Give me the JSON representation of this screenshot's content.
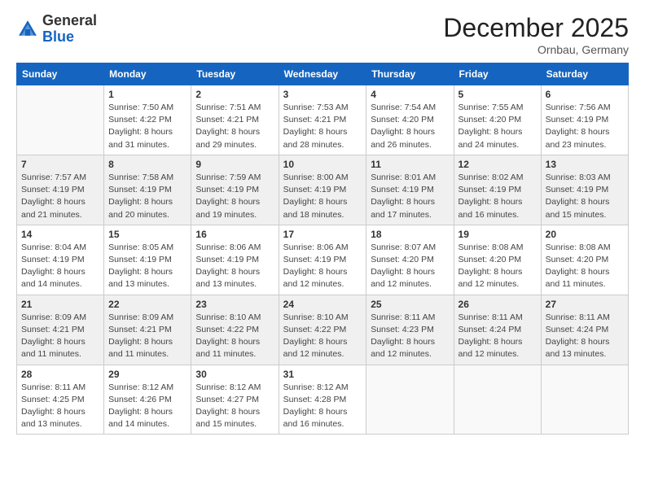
{
  "logo": {
    "general": "General",
    "blue": "Blue"
  },
  "title": "December 2025",
  "subtitle": "Ornbau, Germany",
  "headers": [
    "Sunday",
    "Monday",
    "Tuesday",
    "Wednesday",
    "Thursday",
    "Friday",
    "Saturday"
  ],
  "weeks": [
    [
      {
        "day": "",
        "info": ""
      },
      {
        "day": "1",
        "info": "Sunrise: 7:50 AM\nSunset: 4:22 PM\nDaylight: 8 hours\nand 31 minutes."
      },
      {
        "day": "2",
        "info": "Sunrise: 7:51 AM\nSunset: 4:21 PM\nDaylight: 8 hours\nand 29 minutes."
      },
      {
        "day": "3",
        "info": "Sunrise: 7:53 AM\nSunset: 4:21 PM\nDaylight: 8 hours\nand 28 minutes."
      },
      {
        "day": "4",
        "info": "Sunrise: 7:54 AM\nSunset: 4:20 PM\nDaylight: 8 hours\nand 26 minutes."
      },
      {
        "day": "5",
        "info": "Sunrise: 7:55 AM\nSunset: 4:20 PM\nDaylight: 8 hours\nand 24 minutes."
      },
      {
        "day": "6",
        "info": "Sunrise: 7:56 AM\nSunset: 4:19 PM\nDaylight: 8 hours\nand 23 minutes."
      }
    ],
    [
      {
        "day": "7",
        "info": "Sunrise: 7:57 AM\nSunset: 4:19 PM\nDaylight: 8 hours\nand 21 minutes."
      },
      {
        "day": "8",
        "info": "Sunrise: 7:58 AM\nSunset: 4:19 PM\nDaylight: 8 hours\nand 20 minutes."
      },
      {
        "day": "9",
        "info": "Sunrise: 7:59 AM\nSunset: 4:19 PM\nDaylight: 8 hours\nand 19 minutes."
      },
      {
        "day": "10",
        "info": "Sunrise: 8:00 AM\nSunset: 4:19 PM\nDaylight: 8 hours\nand 18 minutes."
      },
      {
        "day": "11",
        "info": "Sunrise: 8:01 AM\nSunset: 4:19 PM\nDaylight: 8 hours\nand 17 minutes."
      },
      {
        "day": "12",
        "info": "Sunrise: 8:02 AM\nSunset: 4:19 PM\nDaylight: 8 hours\nand 16 minutes."
      },
      {
        "day": "13",
        "info": "Sunrise: 8:03 AM\nSunset: 4:19 PM\nDaylight: 8 hours\nand 15 minutes."
      }
    ],
    [
      {
        "day": "14",
        "info": "Sunrise: 8:04 AM\nSunset: 4:19 PM\nDaylight: 8 hours\nand 14 minutes."
      },
      {
        "day": "15",
        "info": "Sunrise: 8:05 AM\nSunset: 4:19 PM\nDaylight: 8 hours\nand 13 minutes."
      },
      {
        "day": "16",
        "info": "Sunrise: 8:06 AM\nSunset: 4:19 PM\nDaylight: 8 hours\nand 13 minutes."
      },
      {
        "day": "17",
        "info": "Sunrise: 8:06 AM\nSunset: 4:19 PM\nDaylight: 8 hours\nand 12 minutes."
      },
      {
        "day": "18",
        "info": "Sunrise: 8:07 AM\nSunset: 4:20 PM\nDaylight: 8 hours\nand 12 minutes."
      },
      {
        "day": "19",
        "info": "Sunrise: 8:08 AM\nSunset: 4:20 PM\nDaylight: 8 hours\nand 12 minutes."
      },
      {
        "day": "20",
        "info": "Sunrise: 8:08 AM\nSunset: 4:20 PM\nDaylight: 8 hours\nand 11 minutes."
      }
    ],
    [
      {
        "day": "21",
        "info": "Sunrise: 8:09 AM\nSunset: 4:21 PM\nDaylight: 8 hours\nand 11 minutes."
      },
      {
        "day": "22",
        "info": "Sunrise: 8:09 AM\nSunset: 4:21 PM\nDaylight: 8 hours\nand 11 minutes."
      },
      {
        "day": "23",
        "info": "Sunrise: 8:10 AM\nSunset: 4:22 PM\nDaylight: 8 hours\nand 11 minutes."
      },
      {
        "day": "24",
        "info": "Sunrise: 8:10 AM\nSunset: 4:22 PM\nDaylight: 8 hours\nand 12 minutes."
      },
      {
        "day": "25",
        "info": "Sunrise: 8:11 AM\nSunset: 4:23 PM\nDaylight: 8 hours\nand 12 minutes."
      },
      {
        "day": "26",
        "info": "Sunrise: 8:11 AM\nSunset: 4:24 PM\nDaylight: 8 hours\nand 12 minutes."
      },
      {
        "day": "27",
        "info": "Sunrise: 8:11 AM\nSunset: 4:24 PM\nDaylight: 8 hours\nand 13 minutes."
      }
    ],
    [
      {
        "day": "28",
        "info": "Sunrise: 8:11 AM\nSunset: 4:25 PM\nDaylight: 8 hours\nand 13 minutes."
      },
      {
        "day": "29",
        "info": "Sunrise: 8:12 AM\nSunset: 4:26 PM\nDaylight: 8 hours\nand 14 minutes."
      },
      {
        "day": "30",
        "info": "Sunrise: 8:12 AM\nSunset: 4:27 PM\nDaylight: 8 hours\nand 15 minutes."
      },
      {
        "day": "31",
        "info": "Sunrise: 8:12 AM\nSunset: 4:28 PM\nDaylight: 8 hours\nand 16 minutes."
      },
      {
        "day": "",
        "info": ""
      },
      {
        "day": "",
        "info": ""
      },
      {
        "day": "",
        "info": ""
      }
    ]
  ]
}
